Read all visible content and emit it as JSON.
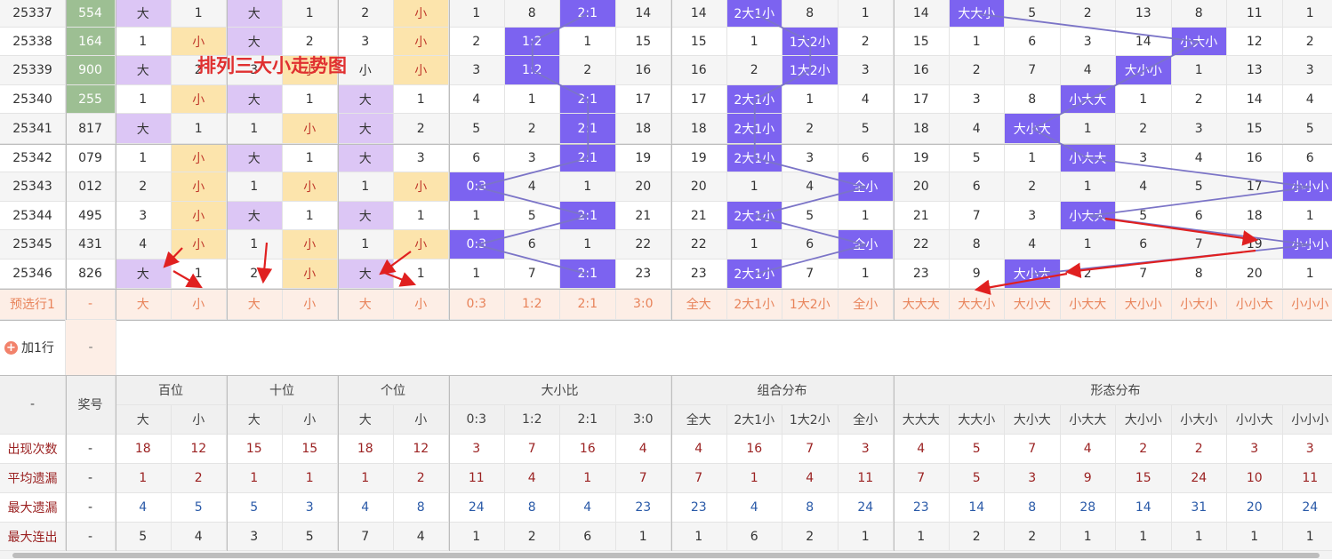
{
  "title": "排列三大小走势图",
  "columns": [
    "大",
    "小",
    "大",
    "小",
    "大",
    "小",
    "0:3",
    "1:2",
    "2:1",
    "3:0",
    "全大",
    "2大1小",
    "1大2小",
    "全小",
    "大大大",
    "大大小",
    "大小大",
    "小大大",
    "大小小",
    "小大小",
    "小小大",
    "小小小"
  ],
  "rows": [
    {
      "period": "25337",
      "num": "554",
      "vals": [
        "大",
        "1",
        "大",
        "1",
        "2",
        "小",
        "1",
        "8",
        "2:1",
        "14",
        "14",
        "2大1小",
        "8",
        "1",
        "14",
        "大大小",
        "5",
        "2",
        "13",
        "8",
        "11",
        "1"
      ]
    },
    {
      "period": "25338",
      "num": "164",
      "vals": [
        "1",
        "小",
        "大",
        "2",
        "3",
        "小",
        "2",
        "1:2",
        "1",
        "15",
        "15",
        "1",
        "1大2小",
        "2",
        "15",
        "1",
        "6",
        "3",
        "14",
        "小大小",
        "12",
        "2"
      ]
    },
    {
      "period": "25339",
      "num": "900",
      "vals": [
        "大",
        "2",
        "3",
        "小",
        "小",
        "小",
        "3",
        "1:2",
        "2",
        "16",
        "16",
        "2",
        "1大2小",
        "3",
        "16",
        "2",
        "7",
        "4",
        "大小小",
        "1",
        "13",
        "3"
      ]
    },
    {
      "period": "25340",
      "num": "255",
      "vals": [
        "1",
        "小",
        "大",
        "1",
        "大",
        "1",
        "4",
        "1",
        "2:1",
        "17",
        "17",
        "2大1小",
        "1",
        "4",
        "17",
        "3",
        "8",
        "小大大",
        "1",
        "2",
        "14",
        "4"
      ]
    },
    {
      "period": "25341",
      "num": "817",
      "vals": [
        "大",
        "1",
        "1",
        "小",
        "大",
        "2",
        "5",
        "2",
        "2:1",
        "18",
        "18",
        "2大1小",
        "2",
        "5",
        "18",
        "4",
        "大小大",
        "1",
        "2",
        "3",
        "15",
        "5"
      ]
    },
    {
      "period": "25342",
      "num": "079",
      "vals": [
        "1",
        "小",
        "大",
        "1",
        "大",
        "3",
        "6",
        "3",
        "2:1",
        "19",
        "19",
        "2大1小",
        "3",
        "6",
        "19",
        "5",
        "1",
        "小大大",
        "3",
        "4",
        "16",
        "6"
      ]
    },
    {
      "period": "25343",
      "num": "012",
      "vals": [
        "2",
        "小",
        "1",
        "小",
        "1",
        "小",
        "0:3",
        "4",
        "1",
        "20",
        "20",
        "1",
        "4",
        "全小",
        "20",
        "6",
        "2",
        "1",
        "4",
        "5",
        "17",
        "小小小"
      ]
    },
    {
      "period": "25344",
      "num": "495",
      "vals": [
        "3",
        "小",
        "大",
        "1",
        "大",
        "1",
        "1",
        "5",
        "2:1",
        "21",
        "21",
        "2大1小",
        "5",
        "1",
        "21",
        "7",
        "3",
        "小大大",
        "5",
        "6",
        "18",
        "1"
      ]
    },
    {
      "period": "25345",
      "num": "431",
      "vals": [
        "4",
        "小",
        "1",
        "小",
        "1",
        "小",
        "0:3",
        "6",
        "1",
        "22",
        "22",
        "1",
        "6",
        "全小",
        "22",
        "8",
        "4",
        "1",
        "6",
        "7",
        "19",
        "小小小"
      ]
    },
    {
      "period": "25346",
      "num": "826",
      "vals": [
        "大",
        "1",
        "2",
        "小",
        "大",
        "1",
        "1",
        "7",
        "2:1",
        "23",
        "23",
        "2大1小",
        "7",
        "1",
        "23",
        "9",
        "大小大",
        "2",
        "7",
        "8",
        "20",
        "1"
      ]
    }
  ],
  "presel": {
    "label": "预选行1",
    "dash": "-",
    "vals": [
      "大",
      "小",
      "大",
      "小",
      "大",
      "小",
      "0:3",
      "1:2",
      "2:1",
      "3:0",
      "全大",
      "2大1小",
      "1大2小",
      "全小",
      "大大大",
      "大大小",
      "大小大",
      "小大大",
      "大小小",
      "小大小",
      "小小大",
      "小小小"
    ]
  },
  "add_row": {
    "label": "加1行",
    "dash": "-"
  },
  "header": {
    "dash": "-",
    "prize": "奖号",
    "groups": [
      "百位",
      "十位",
      "个位",
      "大小比",
      "组合分布",
      "形态分布"
    ]
  },
  "stats": [
    {
      "label": "出现次数",
      "dash": "-",
      "vals": [
        "18",
        "12",
        "15",
        "15",
        "18",
        "12",
        "3",
        "7",
        "16",
        "4",
        "4",
        "16",
        "7",
        "3",
        "4",
        "5",
        "7",
        "4",
        "2",
        "2",
        "3",
        "3"
      ]
    },
    {
      "label": "平均遗漏",
      "dash": "-",
      "vals": [
        "1",
        "2",
        "1",
        "1",
        "1",
        "2",
        "11",
        "4",
        "1",
        "7",
        "7",
        "1",
        "4",
        "11",
        "7",
        "5",
        "3",
        "9",
        "15",
        "24",
        "10",
        "11"
      ]
    },
    {
      "label": "最大遗漏",
      "dash": "-",
      "vals": [
        "4",
        "5",
        "5",
        "3",
        "4",
        "8",
        "24",
        "8",
        "4",
        "23",
        "23",
        "4",
        "8",
        "24",
        "23",
        "14",
        "8",
        "28",
        "14",
        "31",
        "20",
        "24"
      ]
    },
    {
      "label": "最大连出",
      "dash": "-",
      "vals": [
        "5",
        "4",
        "3",
        "5",
        "7",
        "4",
        "1",
        "2",
        "6",
        "1",
        "1",
        "6",
        "2",
        "1",
        "1",
        "2",
        "2",
        "1",
        "1",
        "1",
        "1",
        "1"
      ]
    }
  ],
  "colors": {
    "green": "#9dbf93",
    "purple": "#dcc6f5",
    "yellow": "#fce4ac",
    "blue": "#7c63f0",
    "line": "#7b74c7",
    "arrow": "#e02020"
  }
}
